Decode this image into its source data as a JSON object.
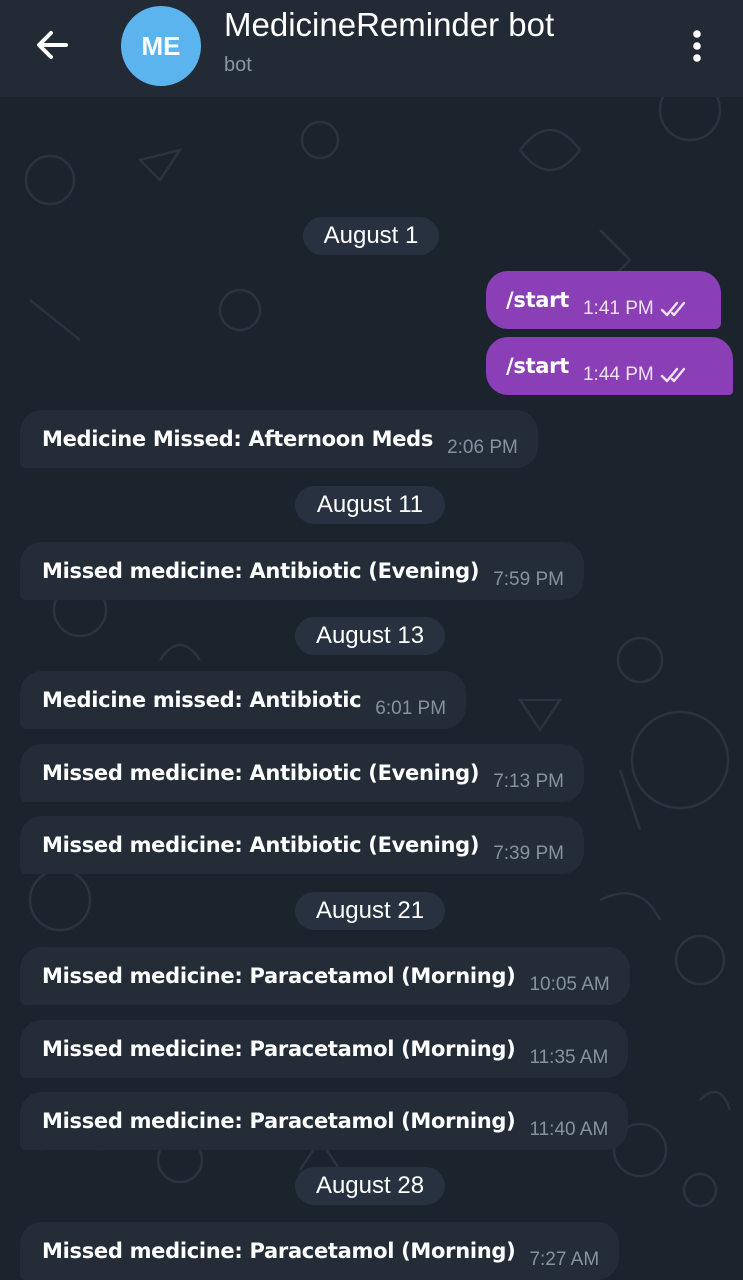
{
  "header": {
    "back_icon": "arrow-left-icon",
    "avatar_initials": "ME",
    "title": "MedicineReminder bot",
    "subtitle": "bot",
    "menu_icon": "more-vertical-icon",
    "avatar_color": "#5bb4ee"
  },
  "colors": {
    "background": "#1b232c",
    "header": "#222b35",
    "incoming_bubble": "#232c37",
    "outgoing_bubble": "#8a3fb6"
  },
  "chat": {
    "dates": [
      "August 1",
      "August 11",
      "August 13",
      "August 21",
      "August 28"
    ],
    "messages": [
      {
        "direction": "out",
        "text": "/start",
        "time": "1:41 PM",
        "status_icon": "double-check-icon"
      },
      {
        "direction": "out",
        "text": "/start",
        "time": "1:44 PM",
        "status_icon": "double-check-icon"
      },
      {
        "direction": "in",
        "text": "Medicine Missed: Afternoon Meds",
        "time": "2:06 PM"
      },
      {
        "direction": "in",
        "text": "Missed medicine: Antibiotic (Evening)",
        "time": "7:59 PM"
      },
      {
        "direction": "in",
        "text": "Medicine missed: Antibiotic",
        "time": "6:01 PM"
      },
      {
        "direction": "in",
        "text": "Missed medicine: Antibiotic (Evening)",
        "time": "7:13 PM"
      },
      {
        "direction": "in",
        "text": "Missed medicine: Antibiotic (Evening)",
        "time": "7:39 PM"
      },
      {
        "direction": "in",
        "text": "Missed medicine: Paracetamol (Morning)",
        "time": "10:05 AM"
      },
      {
        "direction": "in",
        "text": "Missed medicine: Paracetamol (Morning)",
        "time": "11:35 AM"
      },
      {
        "direction": "in",
        "text": "Missed medicine: Paracetamol (Morning)",
        "time": "11:40 AM"
      },
      {
        "direction": "in",
        "text": "Missed medicine: Paracetamol (Morning)",
        "time": "7:27 AM"
      }
    ]
  }
}
